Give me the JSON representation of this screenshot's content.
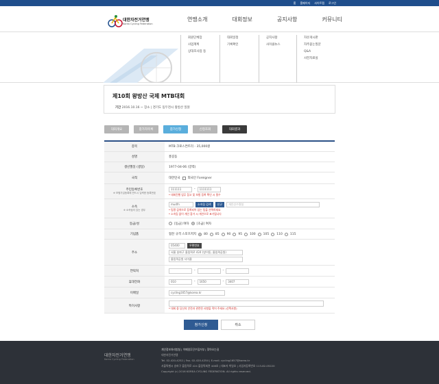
{
  "topbar": {
    "links": [
      "홈",
      "홈페이지",
      "사이트맵",
      "로그인"
    ]
  },
  "logo": {
    "name": "대한자전거연맹",
    "sub": "Korea Cycling Federation"
  },
  "gnb": [
    "연맹소개",
    "대회정보",
    "공지사항",
    "커뮤니티"
  ],
  "submenu": {
    "col1": [
      "회원단체장",
      "사업계획",
      "상대조사업 등"
    ],
    "col2": [
      "대회일정",
      "기록확인"
    ],
    "col3": [
      "공지사항",
      "사이클뉴스"
    ],
    "col4": [
      "자유게시판",
      "자주묻는질문",
      "Q&A",
      "사진자료실"
    ]
  },
  "event": {
    "title": "제10회 왕방산 국제 MTB대회",
    "meta_label": "기간",
    "meta": "2016.10.16 ~ 장소 | 경기도 동두천시 왕방산 일원"
  },
  "tabs": [
    {
      "label": "대회개요",
      "color": "#b5b5b5"
    },
    {
      "label": "참가자목록",
      "color": "#b5b5b5"
    },
    {
      "label": "참가신청",
      "color": "#5aaedc"
    },
    {
      "label": "신청조회",
      "color": "#b5b5b5"
    },
    {
      "label": "대회결과",
      "color": "#3a3a3a"
    }
  ],
  "form": {
    "event_label": "종목",
    "event_value": "MTB 크로스컨트리 - 35,000원",
    "name_label": "성명",
    "name_value": "홍길동",
    "birth_label": "생년월일 (생일)",
    "birth_value": "1977-04-06 (양력)",
    "nation_label": "국적",
    "nation_ko": "대한민국",
    "nation_foreign": "외국인 Foreigner",
    "resident_label": "주민등록번호",
    "resident_sub": "※ 보험가입등록에 반드시 입력한 등록번호",
    "resident_front": "111111",
    "resident_back": "1111111",
    "resident_note": "* 대회진행 업무 참고 및 보험 등록 확인 시 필수",
    "team_label": "소속",
    "team_sub": "※ 소속팀이 있는 경우",
    "team_value": "mudfn",
    "team_btn1": "소속팀 검색",
    "team_btn2": "신규",
    "team_placeholder": "개인선수명칭",
    "team_note1": "* 팀명 검색으로 등록되어 있는 팀을 선택하세요",
    "team_note2": "* 소속팀 없이 개인 참가 시 개인으로 표기됩니다",
    "grade_label": "등급/성",
    "grade_opt1": "[동급] 여자",
    "grade_opt2": "[초급] 여자",
    "size_label": "기념품",
    "size_prefix": "협찬 규격 스포츠저지",
    "sizes": [
      "80",
      "85",
      "90",
      "95",
      "100",
      "105",
      "110",
      "115"
    ],
    "addr_label": "주소",
    "addr_zip": "05400",
    "addr_btn": "우편번호",
    "addr_line1": "서울 송파구 올림픽로 424 (방이동, 올림픽공원)",
    "addr_line2": "올림픽공원 사이클",
    "phone_label": "연락처",
    "mobile_label": "휴대전화",
    "mobile_values": [
      "010",
      "1650",
      "3407"
    ],
    "email_label": "이메일",
    "email_value": "cycling1657@korea.kr",
    "memo_label": "특이사항",
    "memo_note": "* 대회 중 당신의 안전과 관련된 사항을 적어 주세요 (선택사항)"
  },
  "actions": {
    "submit": "참가신청",
    "cancel": "취소"
  },
  "footer": {
    "logo_text": "대한자전거연맹",
    "logo_sub": "Korea Cycling Federation",
    "links": "개인정보처리방침 | 이메일무단수집거부 | 찾아오는길",
    "line1": "대한자전거연맹",
    "line2": "Tel. 02-420-4252 | Fax. 02-420-4254 | E-mail. cycling1657@korea.kr",
    "line3": "서울특별시 송파구 올림픽로 424 올림픽회관 408호 | 대표자 박일호 | 사업자등록번호 113-82-05220",
    "line4": "Copyright (c) 2016 KOREA CYCLING FEDERATION. All rights reserved."
  }
}
